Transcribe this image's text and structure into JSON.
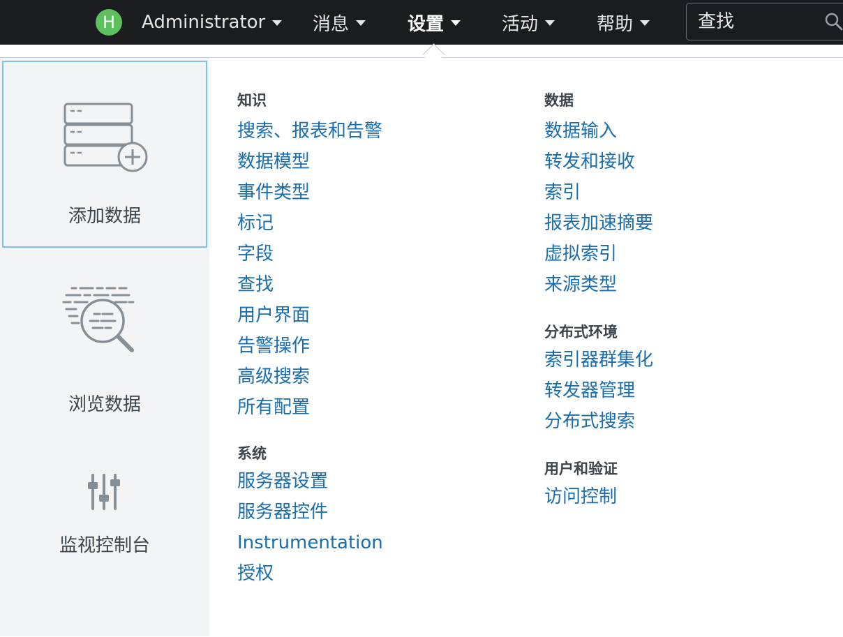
{
  "nav": {
    "user_initial": "H",
    "user_label": "Administrator",
    "messages_label": "消息",
    "settings_label": "设置",
    "activity_label": "活动",
    "help_label": "帮助",
    "search_placeholder": "查找"
  },
  "sidebar": {
    "add_data": "添加数据",
    "explore_data": "浏览数据",
    "monitoring_console": "监视控制台"
  },
  "knowledge": {
    "title": "知识",
    "links": [
      "搜索、报表和告警",
      "数据模型",
      "事件类型",
      "标记",
      "字段",
      "查找",
      "用户界面",
      "告警操作",
      "高级搜索",
      "所有配置"
    ]
  },
  "system": {
    "title": "系统",
    "links": [
      "服务器设置",
      "服务器控件",
      "Instrumentation",
      "授权"
    ]
  },
  "data": {
    "title": "数据",
    "links": [
      "数据输入",
      "转发和接收",
      "索引",
      "报表加速摘要",
      "虚拟索引",
      "来源类型"
    ]
  },
  "distributed": {
    "title": "分布式环境",
    "links": [
      "索引器群集化",
      "转发器管理",
      "分布式搜索"
    ]
  },
  "users_auth": {
    "title": "用户和验证",
    "links": [
      "访问控制"
    ]
  },
  "colors": {
    "topbar": "#1a1c20",
    "link": "#1a6eae",
    "badge": "#5cc05c",
    "selected_border": "#7fbfe8"
  }
}
